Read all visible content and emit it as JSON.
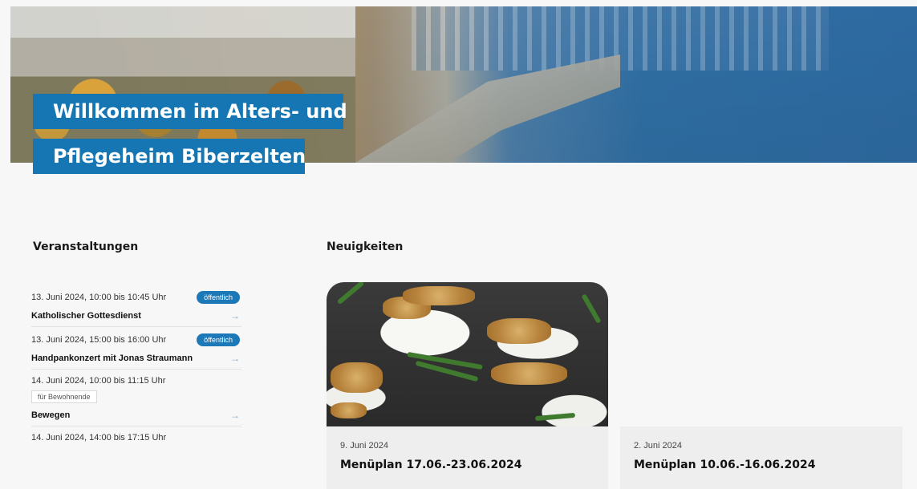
{
  "hero": {
    "title_line1": "Willkommen im Alters- und",
    "title_line2": "Pflegeheim Biberzelten"
  },
  "events": {
    "title": "Veranstaltungen",
    "items": [
      {
        "date": "13. Juni 2024, 10:00 bis 10:45 Uhr",
        "badge": "öffentlich",
        "name": "Katholischer Gottesdienst",
        "tag": ""
      },
      {
        "date": "13. Juni 2024, 15:00 bis 16:00 Uhr",
        "badge": "öffentlich",
        "name": "Handpankonzert mit Jonas Straumann",
        "tag": ""
      },
      {
        "date": "14. Juni 2024, 10:00 bis 11:15 Uhr",
        "badge": "",
        "name": "Bewegen",
        "tag": "für Bewohnende"
      },
      {
        "date": "14. Juni 2024, 14:00 bis 17:15 Uhr",
        "badge": "",
        "name": "",
        "tag": ""
      }
    ]
  },
  "news": {
    "title": "Neuigkeiten",
    "items": [
      {
        "date": "9. Juni 2024",
        "headline": "Menüplan 17.06.-23.06.2024"
      },
      {
        "date": "2. Juni 2024",
        "headline": "Menüplan 10.06.-16.06.2024"
      }
    ]
  },
  "colors": {
    "brand_blue": "#1576b3",
    "badge_blue": "#1c78b6",
    "card_gray": "#eeeeee"
  },
  "icons": {
    "event_link": "arrow-right-icon"
  }
}
